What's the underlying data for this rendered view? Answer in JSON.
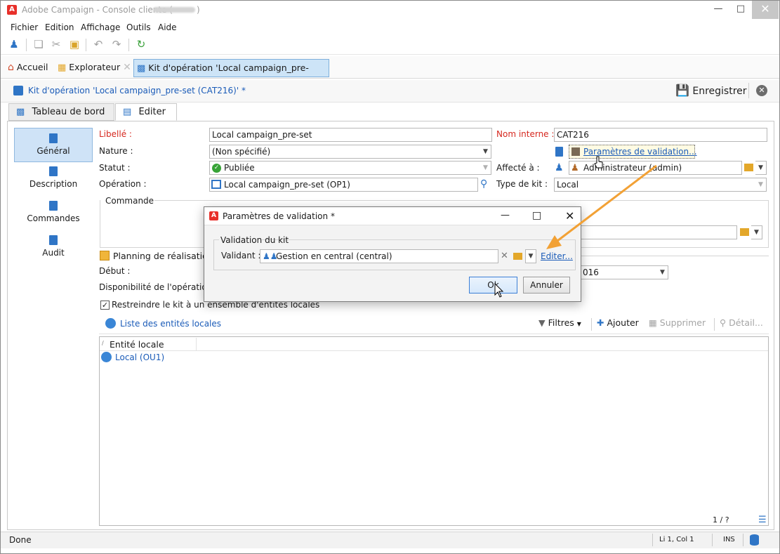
{
  "window": {
    "title": "Adobe Campaign - Console cliente (",
    "title_suffix": ")"
  },
  "menu": [
    "Fichier",
    "Edition",
    "Affichage",
    "Outils",
    "Aide"
  ],
  "tabs": {
    "home": "Accueil",
    "explorer": "Explorateur",
    "active": "Kit d'opération 'Local campaign_pre-set..."
  },
  "breadcrumb": "Kit d'opération 'Local campaign_pre-set (CAT216)' *",
  "save_label": "Enregistrer",
  "view_tabs": [
    "Tableau de bord",
    "Editer"
  ],
  "sidebar": [
    "Général",
    "Description",
    "Commandes",
    "Audit"
  ],
  "form": {
    "libelle_label": "Libellé :",
    "libelle_value": "Local campaign_pre-set",
    "nature_label": "Nature :",
    "nature_value": "(Non spécifié)",
    "statut_label": "Statut :",
    "statut_value": "Publiée",
    "operation_label": "Opération :",
    "operation_value": "Local campaign_pre-set (OP1)",
    "nom_interne_label": "Nom interne :",
    "nom_interne_value": "CAT216",
    "params_link": "Paramètres de validation...",
    "affecte_label": "Affecté à :",
    "affecte_value": "Administrateur (admin)",
    "type_kit_label": "Type de kit :",
    "type_kit_value": "Local",
    "commande_label": "Commande",
    "planning_label": "Planning de réalisation",
    "debut_label": "Début :",
    "date_partial": "016",
    "disponibilite_label": "Disponibilité de l'opération",
    "restrict_label": "Restreindre le kit à un ensemble d'entités locales"
  },
  "entities": {
    "list_label": "Liste des entités locales",
    "filters": "Filtres",
    "add": "Ajouter",
    "delete": "Supprimer",
    "detail": "Détail...",
    "column": "Entité locale",
    "rows": [
      "Local (OU1)"
    ],
    "pager": "1 / ?"
  },
  "dialog": {
    "title": "Paramètres de validation *",
    "group": "Validation du kit",
    "validant_label": "Validant :",
    "validant_value": "Gestion en central (central)",
    "edit_link": "Editer...",
    "ok": "Ok",
    "cancel": "Annuler"
  },
  "status": {
    "left": "Done",
    "position": "Li 1, Col 1",
    "mode": "INS"
  },
  "colors": {
    "accent_blue": "#2f75c6",
    "required_red": "#d6281f",
    "arrow_orange": "#f2a135",
    "brand_red": "#e8302a"
  }
}
